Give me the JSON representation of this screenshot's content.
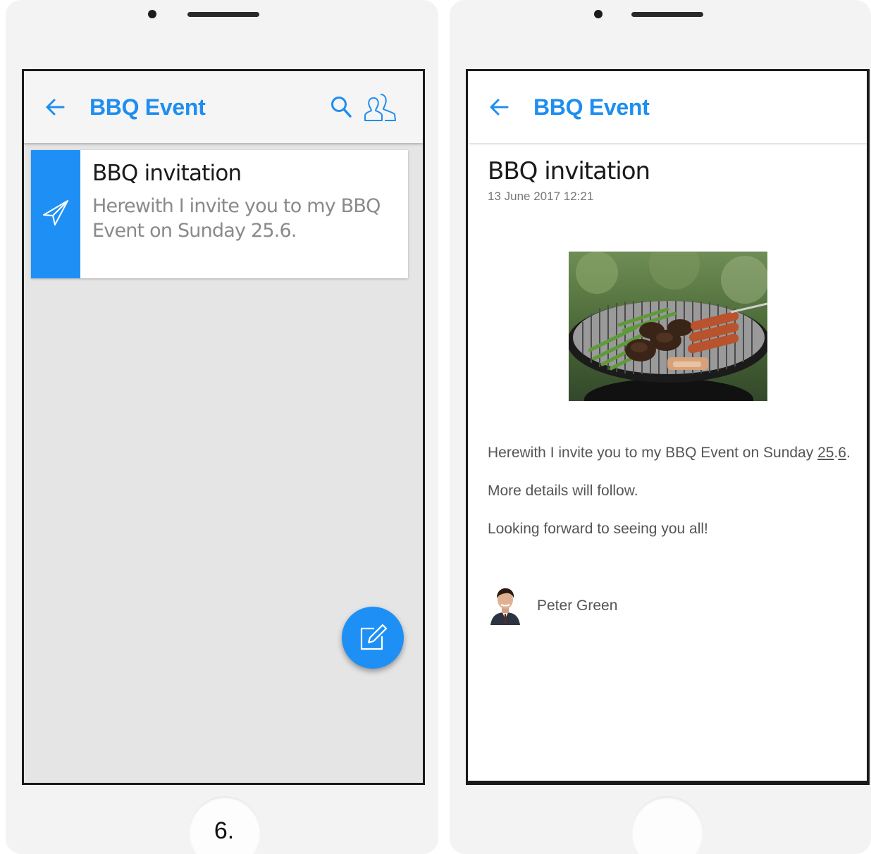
{
  "step_number": "6.",
  "list_screen": {
    "app_bar": {
      "title": "BBQ Event",
      "back_icon": "arrow-left-icon",
      "search_icon": "search-icon",
      "members_icon": "group-icon"
    },
    "messages": [
      {
        "title": "BBQ invitation",
        "preview": "Herewith I invite you to my BBQ Event on Sunday 25.6.",
        "strip_icon": "send-icon",
        "strip_color": "#1e90f5"
      }
    ],
    "fab": {
      "icon": "edit-icon",
      "color": "#1e90f5"
    }
  },
  "detail_screen": {
    "app_bar": {
      "title": "BBQ Event",
      "back_icon": "arrow-left-icon"
    },
    "message": {
      "title": "BBQ invitation",
      "date": "13 June 2017 12:21",
      "image": "bbq-grill-photo",
      "paragraph1_pre": "Herewith I invite you to my BBQ Event on Sunday ",
      "paragraph1_num_a": "25",
      "paragraph1_dot": ".",
      "paragraph1_num_b": "6",
      "paragraph1_end": ".",
      "paragraph2": "More details will follow.",
      "paragraph3": "Looking forward to seeing you all!",
      "sender": "Peter Green"
    }
  },
  "colors": {
    "accent": "#1e8ef0",
    "list_background": "#e5e5e5",
    "phone_body": "#f3f3f3"
  }
}
